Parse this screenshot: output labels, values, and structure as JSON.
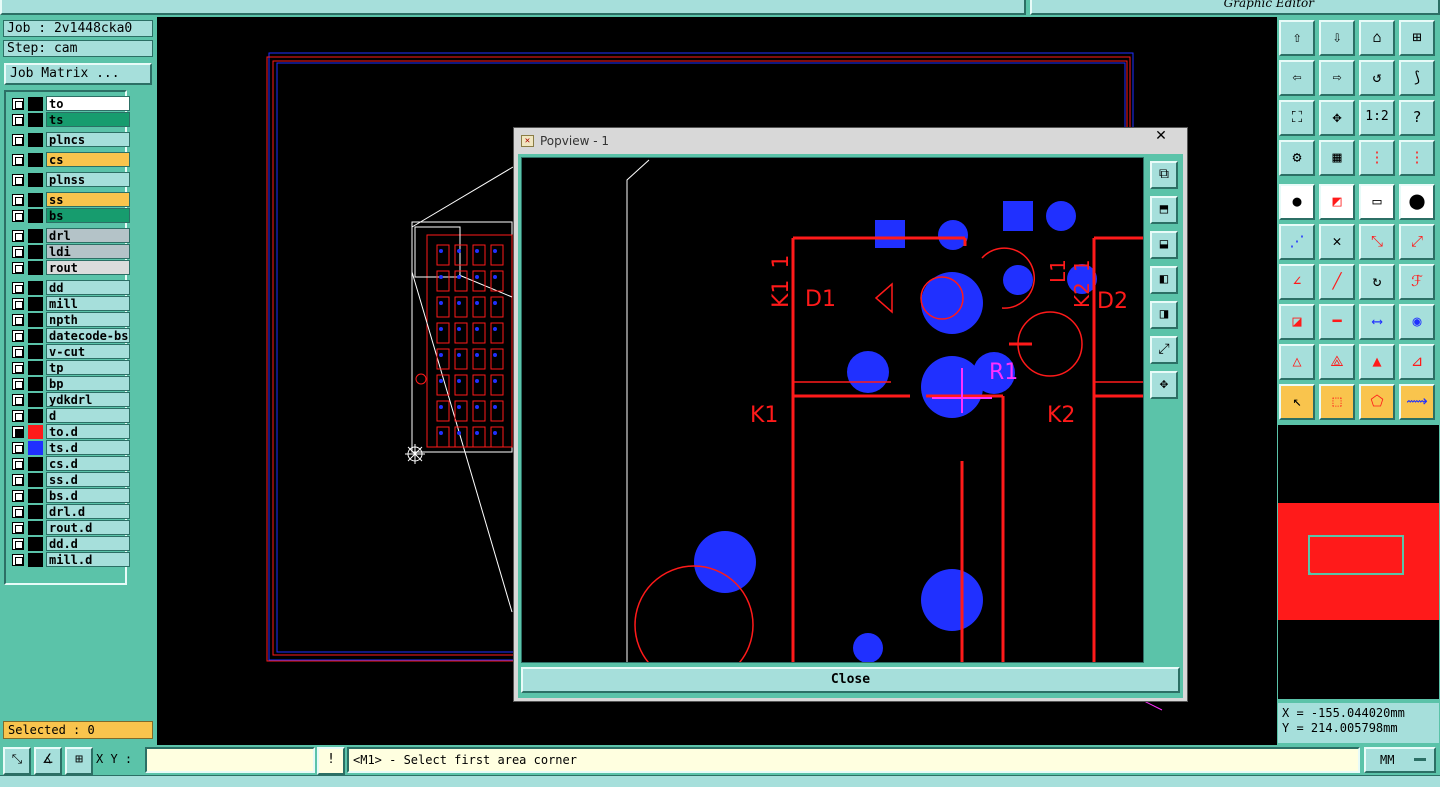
{
  "window": {
    "title": "Graphic Editor"
  },
  "job_info": {
    "job": "Job : 2v1448cka0",
    "step": "Step: cam",
    "matrix_button": "Job Matrix ..."
  },
  "layers": [
    {
      "name": "to",
      "color": "#ffffff",
      "top": 0
    },
    {
      "name": "ts",
      "color": "#179c6e",
      "top": 0
    },
    {
      "name": "plncs",
      "color": "#a6dfdb",
      "top": 0
    },
    {
      "name": "cs",
      "color": "#f9c44d",
      "top": 0
    },
    {
      "name": "plnss",
      "color": "#a6dfdb",
      "top": 0
    },
    {
      "name": "ss",
      "color": "#f9c44d",
      "top": 0
    },
    {
      "name": "bs",
      "color": "#179c6e",
      "top": 0
    },
    {
      "name": "drl",
      "color": "#b4c3c8",
      "top": 0
    },
    {
      "name": "ldi",
      "color": "#b4c3c8",
      "top": 0
    },
    {
      "name": "rout",
      "color": "#dcdcdc",
      "top": 0
    },
    {
      "name": "dd",
      "color": "#a6dfdb",
      "top": 0
    },
    {
      "name": "mill",
      "color": "#a6dfdb",
      "top": 0
    },
    {
      "name": "npth",
      "color": "#a6dfdb",
      "top": 0
    },
    {
      "name": "datecode-bs",
      "color": "#a6dfdb",
      "top": 0
    },
    {
      "name": "v-cut",
      "color": "#a6dfdb",
      "top": 0
    },
    {
      "name": "tp",
      "color": "#a6dfdb",
      "top": 0
    },
    {
      "name": "bp",
      "color": "#a6dfdb",
      "top": 0
    },
    {
      "name": "ydkdrl",
      "color": "#a6dfdb",
      "top": 0
    },
    {
      "name": "d",
      "color": "#a6dfdb",
      "top": 0
    },
    {
      "name": "to.d",
      "color": "#a6dfdb",
      "top": 0,
      "active": true,
      "swatch": "#ff1a1a"
    },
    {
      "name": "ts.d",
      "color": "#a6dfdb",
      "top": 0,
      "swatch": "#2030ff"
    },
    {
      "name": "cs.d",
      "color": "#a6dfdb",
      "top": 0
    },
    {
      "name": "ss.d",
      "color": "#a6dfdb",
      "top": 0
    },
    {
      "name": "bs.d",
      "color": "#a6dfdb",
      "top": 0
    },
    {
      "name": "drl.d",
      "color": "#a6dfdb",
      "top": 0
    },
    {
      "name": "rout.d",
      "color": "#a6dfdb",
      "top": 0
    },
    {
      "name": "dd.d",
      "color": "#a6dfdb",
      "top": 0
    },
    {
      "name": "mill.d",
      "color": "#a6dfdb",
      "top": 0
    }
  ],
  "selected": "Selected : 0",
  "popview": {
    "title": "Popview - 1",
    "close_label": "Close",
    "labels": {
      "k1_1": "K1_1",
      "d1": "D1",
      "d2": "D2",
      "l1": "L1",
      "k2_1": "K2_1",
      "r1": "R1",
      "k1": "K1",
      "k2": "K2"
    }
  },
  "coords": {
    "x": "X = -155.044020mm",
    "y": "Y = 214.005798mm"
  },
  "bottom": {
    "xy_label": "X Y :",
    "xy_value": "",
    "info_icon": "!",
    "prompt": "<M1> - Select first area corner",
    "units": "MM"
  },
  "toolbar_labels": {
    "scale_12": "1:2",
    "help": "?"
  },
  "colors": {
    "red": "#ff1a1a",
    "blue": "#2030ff",
    "magenta": "#ff30ff",
    "teal": "#5bc3a9"
  }
}
